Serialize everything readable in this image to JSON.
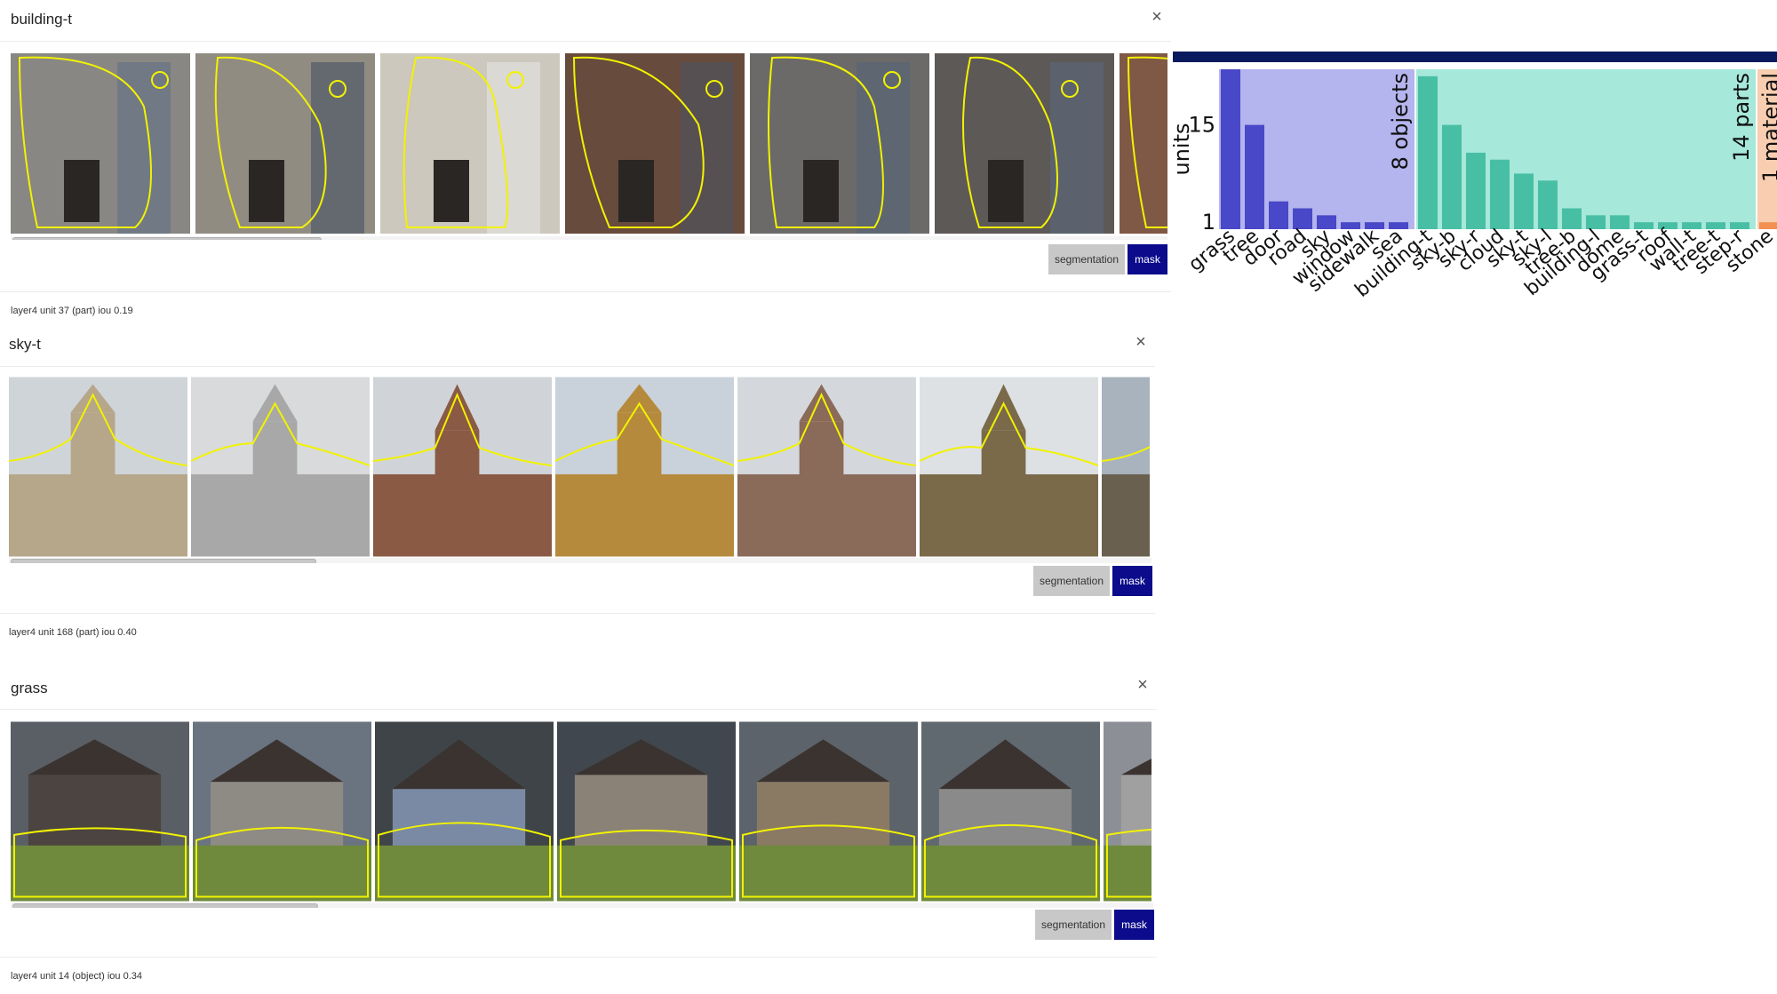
{
  "cards": [
    {
      "title": "building-t",
      "close": "×",
      "segmentation_label": "segmentation",
      "mask_label": "mask",
      "unit_label": "layer4 unit 37 (part) iou 0.19"
    },
    {
      "title": "sky-t",
      "close": "×",
      "segmentation_label": "segmentation",
      "mask_label": "mask",
      "unit_label": "layer4 unit 168 (part) iou 0.40"
    },
    {
      "title": "grass",
      "close": "×",
      "segmentation_label": "segmentation",
      "mask_label": "mask",
      "unit_label": "layer4 unit 14 (object) iou 0.34"
    }
  ],
  "chart_data": {
    "type": "bar",
    "ylabel": "units",
    "yticks": [
      1,
      15
    ],
    "groups": [
      {
        "label": "8 objects",
        "color": "#4848c8",
        "bg": "#b4b4ee",
        "categories": [
          "grass",
          "tree",
          "door",
          "road",
          "sky",
          "window",
          "sidewalk",
          "sea"
        ],
        "values": [
          23,
          15,
          4,
          3,
          2,
          1,
          1,
          1
        ]
      },
      {
        "label": "14 parts",
        "color": "#48bfa4",
        "bg": "#a6e8da",
        "categories": [
          "building-t",
          "sky-b",
          "sky-r",
          "cloud",
          "sky-t",
          "sky-l",
          "tree-b",
          "building-l",
          "dome",
          "grass-t",
          "roof",
          "wall-t",
          "tree-t",
          "step-r"
        ],
        "values": [
          22,
          15,
          11,
          10,
          8,
          7,
          3,
          2,
          2,
          1,
          1,
          1,
          1,
          1
        ]
      },
      {
        "label": "1 material",
        "color": "#f29052",
        "bg": "#f8cdb0",
        "categories": [
          "stone"
        ],
        "values": [
          1
        ]
      }
    ]
  }
}
